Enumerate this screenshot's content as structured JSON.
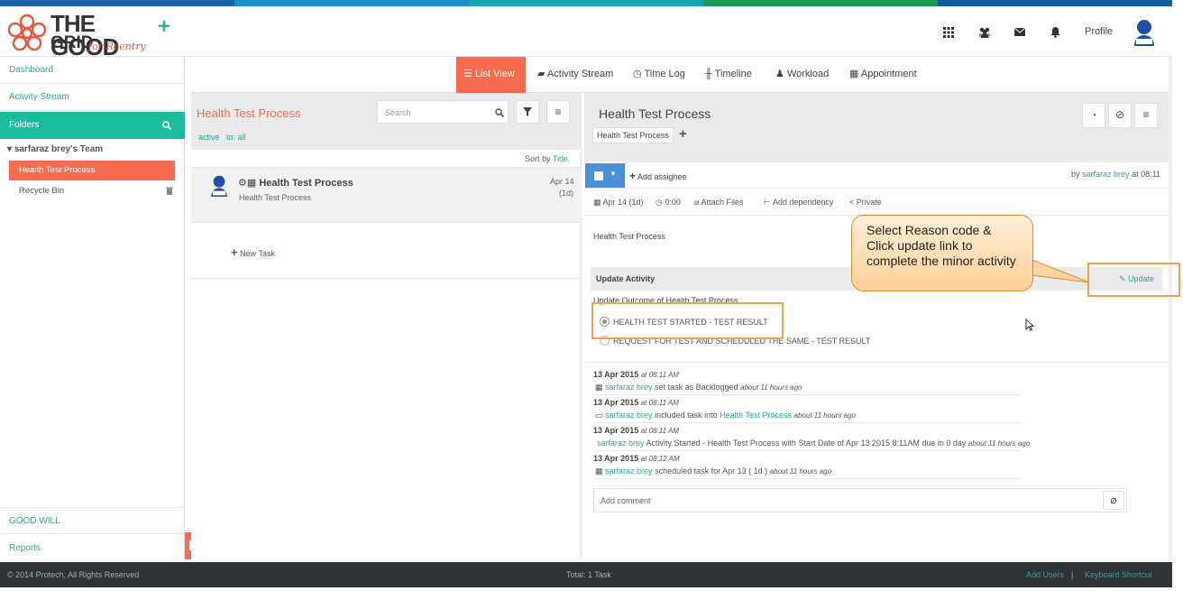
{
  "brand": {
    "line1": "THE GOOD",
    "line2": "GRID",
    "tagline": "for Reentry"
  },
  "colors": {
    "accent": "#f96b4f",
    "teal": "#1abc9c",
    "link": "#26a69a",
    "footer": "#2e3338",
    "callout_border": "#e08a2c"
  },
  "header": {
    "icons": [
      "grid-icon",
      "users-icon",
      "mail-icon",
      "bell-icon"
    ],
    "profile_label": "Profile"
  },
  "sidebar": {
    "items": [
      {
        "label": "Dashboard"
      },
      {
        "label": "Activity Stream"
      }
    ],
    "folders_label": "Folders",
    "team_label": "sarfaraz brey's Team",
    "active_item": "Health Test Process",
    "recycle_bin": "Recycle Bin",
    "bottom_items": [
      {
        "label": "GOOD WILL"
      },
      {
        "label": "Reports"
      }
    ]
  },
  "tabs": [
    {
      "label": "List View"
    },
    {
      "label": "Activity Stream"
    },
    {
      "label": "Time Log"
    },
    {
      "label": "Timeline"
    },
    {
      "label": "Workload"
    },
    {
      "label": "Appointment"
    }
  ],
  "list": {
    "title": "Health Test Process",
    "search_placeholder": "Search",
    "filter_active": "active",
    "filter_to": "to: all",
    "sort_label": "Sort by",
    "sort_value": "Title",
    "task": {
      "title": "Health Test Process",
      "subtitle": "Health Test Process",
      "date": "Apr 14",
      "duration": "(1d)"
    },
    "new_task": "New Task"
  },
  "detail": {
    "title": "Health Test Process",
    "tag": "Health Test Process",
    "add_assignee": "Add assignee",
    "by_label": "by",
    "by_user": "sarfaraz brey",
    "by_time": "at 08:11",
    "meta": {
      "date": "Apr 14 (1d)",
      "time": "0:00",
      "attach": "Attach Files",
      "dependency": "Add dependency",
      "privacy": "Private"
    },
    "description": "Health Test Process",
    "update_activity": "Update Activity",
    "update_link": "Update",
    "outcome_label": "Update Outcome of Health Test Process",
    "options": [
      "HEALTH TEST STARTED - TEST RESULT",
      "REQUEST FOR TEST AND SCHEDULED THE SAME - TEST RESULT"
    ],
    "activities": [
      {
        "date": "13 Apr 2015",
        "time": "at 08:11 AM",
        "user": "sarfaraz brey",
        "text": "set task as Backlogged",
        "link": "",
        "ago": "about 11 hours ago"
      },
      {
        "date": "13 Apr 2015",
        "time": "at 08:11 AM",
        "user": "sarfaraz brey",
        "text": "included task into",
        "link": "Health Test Process",
        "ago": "about 11 hours ago"
      },
      {
        "date": "13 Apr 2015",
        "time": "at 08:11 AM",
        "user": "sarfaraz brey",
        "text": "Activity Started - Health Test Process with Start Date of Apr 13 2015 8:11AM due in 0 day",
        "link": "",
        "ago": "about 11 hours ago"
      },
      {
        "date": "13 Apr 2015",
        "time": "at 08:12 AM",
        "user": "sarfaraz brey",
        "text": "scheduled task for Apr 13 ( 1d )",
        "link": "",
        "ago": "about 11 hours ago"
      }
    ],
    "comment_placeholder": "Add comment"
  },
  "callout": {
    "text": "Select Reason code & Click update link to complete the minor activity"
  },
  "footer": {
    "copyright": "© 2014 Protech, All Rights Reserved",
    "total": "Total: 1 Task",
    "add_users": "Add Users",
    "separator": "|",
    "shortcut": "Keyboard Shortcut"
  }
}
